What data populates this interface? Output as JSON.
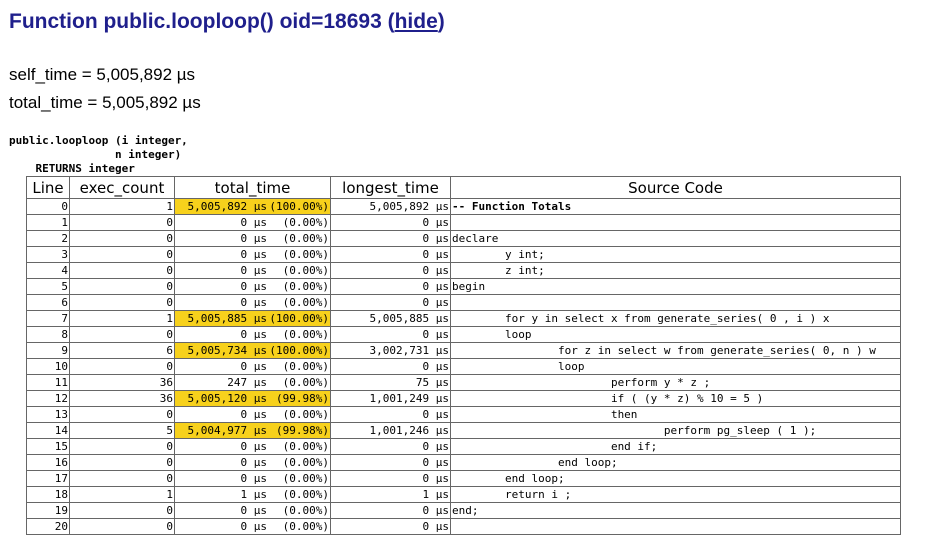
{
  "header": {
    "title_prefix": "Function public.looploop() oid=18693 (",
    "hide_link": "hide",
    "title_suffix": ")"
  },
  "stats": {
    "self_time": "self_time = 5,005,892 µs",
    "total_time": "total_time = 5,005,892 µs"
  },
  "signature": "public.looploop (i integer,\n                n integer)\n    RETURNS integer",
  "table": {
    "columns": [
      "Line",
      "exec_count",
      "total_time",
      "longest_time",
      "Source Code"
    ],
    "rows": [
      {
        "line": "0",
        "exec_count": "1",
        "total_time": "5,005,892 µs",
        "pct": "(100.00%)",
        "longest_time": "5,005,892 µs",
        "source": "-- Function Totals",
        "highlight": true,
        "bold": true
      },
      {
        "line": "1",
        "exec_count": "0",
        "total_time": "0 µs",
        "pct": "(0.00%)",
        "longest_time": "0 µs",
        "source": "",
        "highlight": false
      },
      {
        "line": "2",
        "exec_count": "0",
        "total_time": "0 µs",
        "pct": "(0.00%)",
        "longest_time": "0 µs",
        "source": "declare",
        "highlight": false
      },
      {
        "line": "3",
        "exec_count": "0",
        "total_time": "0 µs",
        "pct": "(0.00%)",
        "longest_time": "0 µs",
        "source": "        y int;",
        "highlight": false
      },
      {
        "line": "4",
        "exec_count": "0",
        "total_time": "0 µs",
        "pct": "(0.00%)",
        "longest_time": "0 µs",
        "source": "        z int;",
        "highlight": false
      },
      {
        "line": "5",
        "exec_count": "0",
        "total_time": "0 µs",
        "pct": "(0.00%)",
        "longest_time": "0 µs",
        "source": "begin",
        "highlight": false
      },
      {
        "line": "6",
        "exec_count": "0",
        "total_time": "0 µs",
        "pct": "(0.00%)",
        "longest_time": "0 µs",
        "source": "",
        "highlight": false
      },
      {
        "line": "7",
        "exec_count": "1",
        "total_time": "5,005,885 µs",
        "pct": "(100.00%)",
        "longest_time": "5,005,885 µs",
        "source": "        for y in select x from generate_series( 0 , i ) x",
        "highlight": true
      },
      {
        "line": "8",
        "exec_count": "0",
        "total_time": "0 µs",
        "pct": "(0.00%)",
        "longest_time": "0 µs",
        "source": "        loop",
        "highlight": false
      },
      {
        "line": "9",
        "exec_count": "6",
        "total_time": "5,005,734 µs",
        "pct": "(100.00%)",
        "longest_time": "3,002,731 µs",
        "source": "                for z in select w from generate_series( 0, n ) w",
        "highlight": true
      },
      {
        "line": "10",
        "exec_count": "0",
        "total_time": "0 µs",
        "pct": "(0.00%)",
        "longest_time": "0 µs",
        "source": "                loop",
        "highlight": false
      },
      {
        "line": "11",
        "exec_count": "36",
        "total_time": "247 µs",
        "pct": "(0.00%)",
        "longest_time": "75 µs",
        "source": "                        perform y * z ;",
        "highlight": false
      },
      {
        "line": "12",
        "exec_count": "36",
        "total_time": "5,005,120 µs",
        "pct": "(99.98%)",
        "longest_time": "1,001,249 µs",
        "source": "                        if ( (y * z) % 10 = 5 )",
        "highlight": true
      },
      {
        "line": "13",
        "exec_count": "0",
        "total_time": "0 µs",
        "pct": "(0.00%)",
        "longest_time": "0 µs",
        "source": "                        then",
        "highlight": false
      },
      {
        "line": "14",
        "exec_count": "5",
        "total_time": "5,004,977 µs",
        "pct": "(99.98%)",
        "longest_time": "1,001,246 µs",
        "source": "                                perform pg_sleep ( 1 );",
        "highlight": true
      },
      {
        "line": "15",
        "exec_count": "0",
        "total_time": "0 µs",
        "pct": "(0.00%)",
        "longest_time": "0 µs",
        "source": "                        end if;",
        "highlight": false
      },
      {
        "line": "16",
        "exec_count": "0",
        "total_time": "0 µs",
        "pct": "(0.00%)",
        "longest_time": "0 µs",
        "source": "                end loop;",
        "highlight": false
      },
      {
        "line": "17",
        "exec_count": "0",
        "total_time": "0 µs",
        "pct": "(0.00%)",
        "longest_time": "0 µs",
        "source": "        end loop;",
        "highlight": false
      },
      {
        "line": "18",
        "exec_count": "1",
        "total_time": "1 µs",
        "pct": "(0.00%)",
        "longest_time": "1 µs",
        "source": "        return i ;",
        "highlight": false
      },
      {
        "line": "19",
        "exec_count": "0",
        "total_time": "0 µs",
        "pct": "(0.00%)",
        "longest_time": "0 µs",
        "source": "end;",
        "highlight": false
      },
      {
        "line": "20",
        "exec_count": "0",
        "total_time": "0 µs",
        "pct": "(0.00%)",
        "longest_time": "0 µs",
        "source": "",
        "highlight": false
      }
    ]
  },
  "colors": {
    "title": "#1f1f8c",
    "highlight": "#f7d11c",
    "border": "#666666"
  }
}
